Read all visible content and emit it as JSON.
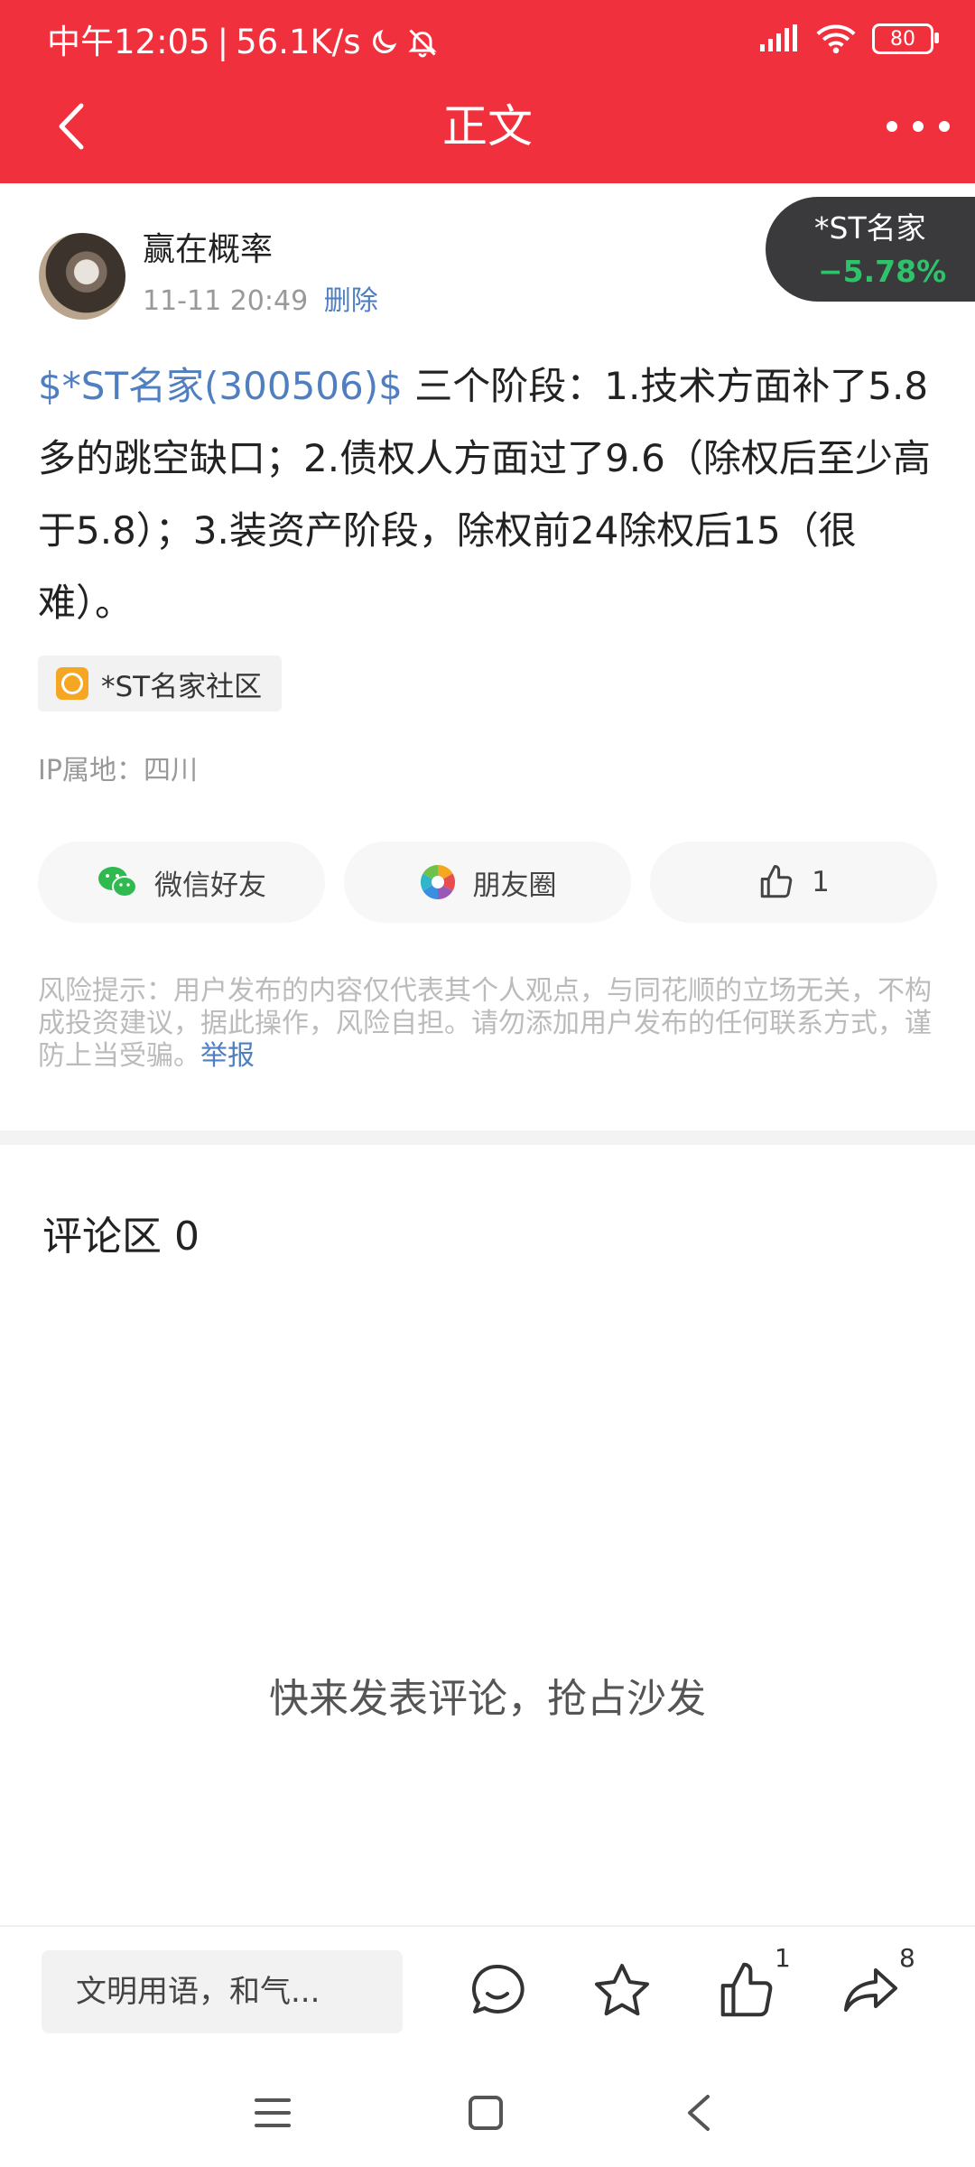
{
  "status_bar": {
    "time": "中午12:05",
    "net_speed": "56.1K/s",
    "battery": "80"
  },
  "header": {
    "title": "正文"
  },
  "author": {
    "name": "赢在概率",
    "timestamp": "11-11 20:49",
    "delete_label": "删除"
  },
  "stock_badge": {
    "name": "*ST名家",
    "change": "−5.78%",
    "change_color": "#2ec26b"
  },
  "post": {
    "stock_link": "$*ST名家(300506)$",
    "text": " 三个阶段：1.技术方面补了5.8多的跳空缺口；2.债权人方面过了9.6（除权后至少高于5.8）；3.装资产阶段，除权前24除权后15（很难）。"
  },
  "tag": {
    "label": "*ST名家社区"
  },
  "ip_location": "IP属地：四川",
  "share": {
    "wechat": "微信好友",
    "moments": "朋友圈",
    "like_count": "1"
  },
  "risk": {
    "text": "风险提示：用户发布的内容仅代表其个人观点，与同花顺的立场无关，不构成投资建议，据此操作，风险自担。请勿添加用户发布的任何联系方式，谨防上当受骗。",
    "report_label": "举报"
  },
  "comments": {
    "title": "评论区 0",
    "empty_hint": "快来发表评论，抢占沙发"
  },
  "bottom_bar": {
    "input_placeholder": "文明用语，和气...",
    "like_count": "1",
    "share_count": "8"
  },
  "colors": {
    "brand": "#f1303d",
    "link": "#4f7fc0"
  }
}
